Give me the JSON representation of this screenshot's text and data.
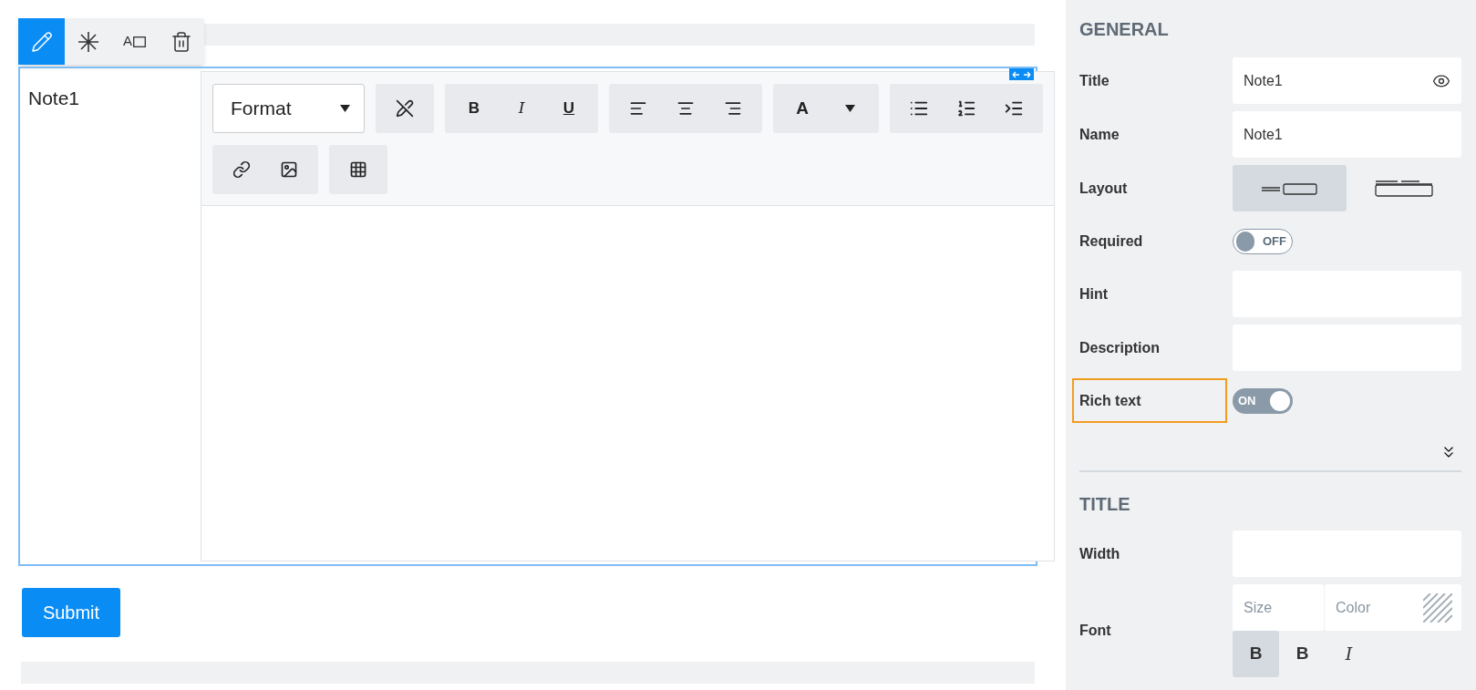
{
  "floating_toolbar": [
    {
      "kind": "edit",
      "selected": true
    },
    {
      "kind": "required",
      "selected": false
    },
    {
      "kind": "title",
      "label": "A",
      "selected": false
    },
    {
      "kind": "delete",
      "selected": false
    }
  ],
  "question": {
    "title": "Note1",
    "editor": {
      "format_select": "Format",
      "style_buttons": [
        {
          "label": "B",
          "kind": "bold"
        },
        {
          "label": "I",
          "kind": "italic"
        },
        {
          "label": "U",
          "kind": "underline"
        }
      ],
      "color_button": "A"
    }
  },
  "submit_button": "Submit",
  "panel": {
    "sections": [
      {
        "heading": "GENERAL",
        "rows": [
          {
            "kind": "text",
            "label": "Title",
            "value": "Note1",
            "eye": true
          },
          {
            "kind": "text",
            "label": "Name",
            "value": "Note1"
          },
          {
            "kind": "layout",
            "label": "Layout",
            "options": [
              {
                "kind": "inline",
                "selected": true
              },
              {
                "kind": "stacked",
                "selected": false
              }
            ]
          },
          {
            "kind": "toggle",
            "label": "Required",
            "on": false,
            "state_text": "OFF"
          },
          {
            "kind": "text",
            "label": "Hint"
          },
          {
            "kind": "text",
            "label": "Description"
          },
          {
            "kind": "toggle",
            "label": "Rich text",
            "on": true,
            "state_text": "ON",
            "highlighted": true
          }
        ]
      },
      {
        "heading": "TITLE",
        "rows": [
          {
            "kind": "text",
            "label": "Width"
          },
          {
            "kind": "font",
            "label": "Font",
            "size_placeholder": "Size",
            "color_placeholder": "Color",
            "styles": [
              {
                "label": "B",
                "kind": "bold",
                "selected": true
              },
              {
                "label": "B",
                "kind": "bold",
                "selected": false
              },
              {
                "label": "I",
                "kind": "italic",
                "selected": false
              }
            ]
          }
        ]
      }
    ]
  }
}
